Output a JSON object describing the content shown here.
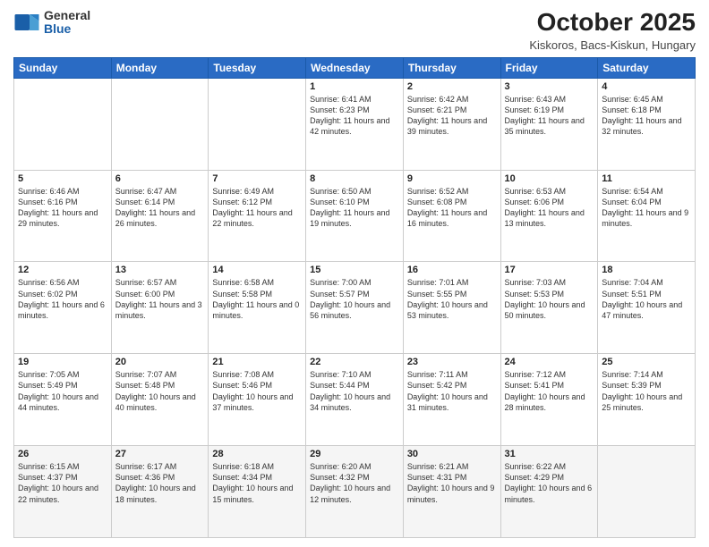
{
  "header": {
    "logo_general": "General",
    "logo_blue": "Blue",
    "month_title": "October 2025",
    "location": "Kiskoros, Bacs-Kiskun, Hungary"
  },
  "days_of_week": [
    "Sunday",
    "Monday",
    "Tuesday",
    "Wednesday",
    "Thursday",
    "Friday",
    "Saturday"
  ],
  "weeks": [
    [
      {
        "day": "",
        "info": ""
      },
      {
        "day": "",
        "info": ""
      },
      {
        "day": "",
        "info": ""
      },
      {
        "day": "1",
        "info": "Sunrise: 6:41 AM\nSunset: 6:23 PM\nDaylight: 11 hours\nand 42 minutes."
      },
      {
        "day": "2",
        "info": "Sunrise: 6:42 AM\nSunset: 6:21 PM\nDaylight: 11 hours\nand 39 minutes."
      },
      {
        "day": "3",
        "info": "Sunrise: 6:43 AM\nSunset: 6:19 PM\nDaylight: 11 hours\nand 35 minutes."
      },
      {
        "day": "4",
        "info": "Sunrise: 6:45 AM\nSunset: 6:18 PM\nDaylight: 11 hours\nand 32 minutes."
      }
    ],
    [
      {
        "day": "5",
        "info": "Sunrise: 6:46 AM\nSunset: 6:16 PM\nDaylight: 11 hours\nand 29 minutes."
      },
      {
        "day": "6",
        "info": "Sunrise: 6:47 AM\nSunset: 6:14 PM\nDaylight: 11 hours\nand 26 minutes."
      },
      {
        "day": "7",
        "info": "Sunrise: 6:49 AM\nSunset: 6:12 PM\nDaylight: 11 hours\nand 22 minutes."
      },
      {
        "day": "8",
        "info": "Sunrise: 6:50 AM\nSunset: 6:10 PM\nDaylight: 11 hours\nand 19 minutes."
      },
      {
        "day": "9",
        "info": "Sunrise: 6:52 AM\nSunset: 6:08 PM\nDaylight: 11 hours\nand 16 minutes."
      },
      {
        "day": "10",
        "info": "Sunrise: 6:53 AM\nSunset: 6:06 PM\nDaylight: 11 hours\nand 13 minutes."
      },
      {
        "day": "11",
        "info": "Sunrise: 6:54 AM\nSunset: 6:04 PM\nDaylight: 11 hours\nand 9 minutes."
      }
    ],
    [
      {
        "day": "12",
        "info": "Sunrise: 6:56 AM\nSunset: 6:02 PM\nDaylight: 11 hours\nand 6 minutes."
      },
      {
        "day": "13",
        "info": "Sunrise: 6:57 AM\nSunset: 6:00 PM\nDaylight: 11 hours\nand 3 minutes."
      },
      {
        "day": "14",
        "info": "Sunrise: 6:58 AM\nSunset: 5:58 PM\nDaylight: 11 hours\nand 0 minutes."
      },
      {
        "day": "15",
        "info": "Sunrise: 7:00 AM\nSunset: 5:57 PM\nDaylight: 10 hours\nand 56 minutes."
      },
      {
        "day": "16",
        "info": "Sunrise: 7:01 AM\nSunset: 5:55 PM\nDaylight: 10 hours\nand 53 minutes."
      },
      {
        "day": "17",
        "info": "Sunrise: 7:03 AM\nSunset: 5:53 PM\nDaylight: 10 hours\nand 50 minutes."
      },
      {
        "day": "18",
        "info": "Sunrise: 7:04 AM\nSunset: 5:51 PM\nDaylight: 10 hours\nand 47 minutes."
      }
    ],
    [
      {
        "day": "19",
        "info": "Sunrise: 7:05 AM\nSunset: 5:49 PM\nDaylight: 10 hours\nand 44 minutes."
      },
      {
        "day": "20",
        "info": "Sunrise: 7:07 AM\nSunset: 5:48 PM\nDaylight: 10 hours\nand 40 minutes."
      },
      {
        "day": "21",
        "info": "Sunrise: 7:08 AM\nSunset: 5:46 PM\nDaylight: 10 hours\nand 37 minutes."
      },
      {
        "day": "22",
        "info": "Sunrise: 7:10 AM\nSunset: 5:44 PM\nDaylight: 10 hours\nand 34 minutes."
      },
      {
        "day": "23",
        "info": "Sunrise: 7:11 AM\nSunset: 5:42 PM\nDaylight: 10 hours\nand 31 minutes."
      },
      {
        "day": "24",
        "info": "Sunrise: 7:12 AM\nSunset: 5:41 PM\nDaylight: 10 hours\nand 28 minutes."
      },
      {
        "day": "25",
        "info": "Sunrise: 7:14 AM\nSunset: 5:39 PM\nDaylight: 10 hours\nand 25 minutes."
      }
    ],
    [
      {
        "day": "26",
        "info": "Sunrise: 6:15 AM\nSunset: 4:37 PM\nDaylight: 10 hours\nand 22 minutes."
      },
      {
        "day": "27",
        "info": "Sunrise: 6:17 AM\nSunset: 4:36 PM\nDaylight: 10 hours\nand 18 minutes."
      },
      {
        "day": "28",
        "info": "Sunrise: 6:18 AM\nSunset: 4:34 PM\nDaylight: 10 hours\nand 15 minutes."
      },
      {
        "day": "29",
        "info": "Sunrise: 6:20 AM\nSunset: 4:32 PM\nDaylight: 10 hours\nand 12 minutes."
      },
      {
        "day": "30",
        "info": "Sunrise: 6:21 AM\nSunset: 4:31 PM\nDaylight: 10 hours\nand 9 minutes."
      },
      {
        "day": "31",
        "info": "Sunrise: 6:22 AM\nSunset: 4:29 PM\nDaylight: 10 hours\nand 6 minutes."
      },
      {
        "day": "",
        "info": ""
      }
    ]
  ]
}
